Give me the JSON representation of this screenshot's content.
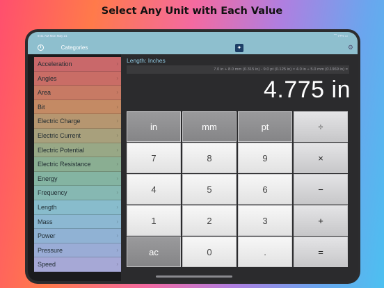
{
  "headline": "Select Any Unit with Each Value",
  "status": {
    "time": "9:41 AM   Mon May 21",
    "right": "⌒ 77% ▭"
  },
  "sidebar": {
    "title": "Categories",
    "items": [
      {
        "label": "Acceleration",
        "color": "#c9686a"
      },
      {
        "label": "Angles",
        "color": "#c96d66"
      },
      {
        "label": "Area",
        "color": "#c77a64"
      },
      {
        "label": "Bit",
        "color": "#c48a64"
      },
      {
        "label": "Electric Charge",
        "color": "#b69670"
      },
      {
        "label": "Electric Current",
        "color": "#a8a07c"
      },
      {
        "label": "Electric Potential",
        "color": "#98a886"
      },
      {
        "label": "Electric Resistance",
        "color": "#8aae92"
      },
      {
        "label": "Energy",
        "color": "#84b4a2"
      },
      {
        "label": "Frequency",
        "color": "#86b8b2"
      },
      {
        "label": "Length",
        "color": "#88bccc"
      },
      {
        "label": "Mass",
        "color": "#8cb8d2"
      },
      {
        "label": "Power",
        "color": "#90b2d4"
      },
      {
        "label": "Pressure",
        "color": "#9aacd6"
      },
      {
        "label": "Speed",
        "color": "#a6a8d6"
      }
    ]
  },
  "main": {
    "unit_label": "Length: Inches",
    "expression": "7.0 in + 8.0 mm (0.315 in) - 9.0 pt (0.125 in) × 4.0 in ÷ 5.0 mm (0.1969 in) =",
    "display": "4.775 in"
  },
  "keypad": [
    {
      "label": "in",
      "type": "unit"
    },
    {
      "label": "mm",
      "type": "unit"
    },
    {
      "label": "pt",
      "type": "unit"
    },
    {
      "label": "÷",
      "type": "op"
    },
    {
      "label": "7",
      "type": "num"
    },
    {
      "label": "8",
      "type": "num"
    },
    {
      "label": "9",
      "type": "num"
    },
    {
      "label": "×",
      "type": "op"
    },
    {
      "label": "4",
      "type": "num"
    },
    {
      "label": "5",
      "type": "num"
    },
    {
      "label": "6",
      "type": "num"
    },
    {
      "label": "−",
      "type": "op"
    },
    {
      "label": "1",
      "type": "num"
    },
    {
      "label": "2",
      "type": "num"
    },
    {
      "label": "3",
      "type": "num"
    },
    {
      "label": "+",
      "type": "op"
    },
    {
      "label": "ac",
      "type": "ac"
    },
    {
      "label": "0",
      "type": "num"
    },
    {
      "label": ".",
      "type": "num"
    },
    {
      "label": "=",
      "type": "op"
    }
  ]
}
